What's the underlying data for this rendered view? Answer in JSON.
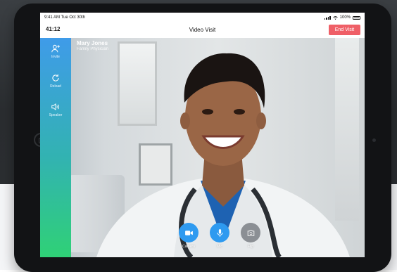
{
  "status_bar": {
    "time": "9:41 AM",
    "date": "Tue Oct 30th",
    "battery": "100%"
  },
  "nav": {
    "timer": "41:12",
    "title": "Video Visit",
    "end_label": "End Visit"
  },
  "caller": {
    "name": "Mary Jones",
    "role": "Family Physician"
  },
  "sidebar": {
    "items": [
      {
        "label": "Invite",
        "icon": "add-user-icon"
      },
      {
        "label": "Reload",
        "icon": "reload-icon"
      },
      {
        "label": "Speaker",
        "icon": "speaker-icon"
      }
    ]
  },
  "controls": [
    {
      "label": "Camera",
      "icon": "video-camera-icon",
      "active": true
    },
    {
      "label": "Mic",
      "icon": "microphone-icon",
      "active": true
    },
    {
      "label": "Flip",
      "icon": "flip-camera-icon",
      "active": false
    }
  ],
  "colors": {
    "end_visit": "#ef5f67",
    "sidebar_top": "#3f9be9",
    "sidebar_bottom": "#2fd176",
    "control_blue": "#2e9af0"
  }
}
